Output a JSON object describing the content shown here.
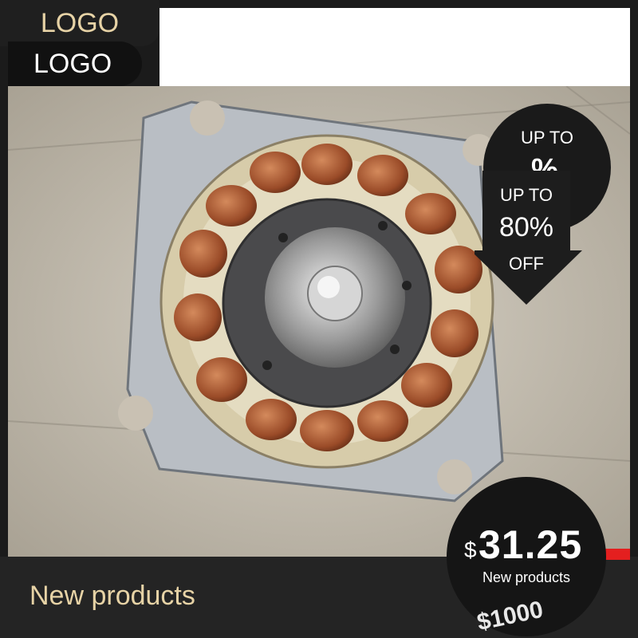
{
  "logos": {
    "primary": "LOGO",
    "secondary": "LOGO"
  },
  "discount": {
    "circle_top": "UP TO",
    "circle_pct": "%",
    "arrow_top": "UP TO",
    "arrow_pct": "80%",
    "arrow_bottom": "OFF"
  },
  "price": {
    "currency": "$",
    "amount": "31.25",
    "caption": "New products",
    "shadow_text": "$1000"
  },
  "footer": {
    "label": "New products"
  },
  "colors": {
    "gold": "#e7d3a6",
    "dark": "#1b1b1b",
    "red": "#e41f1f",
    "copper": "#b5623a"
  }
}
